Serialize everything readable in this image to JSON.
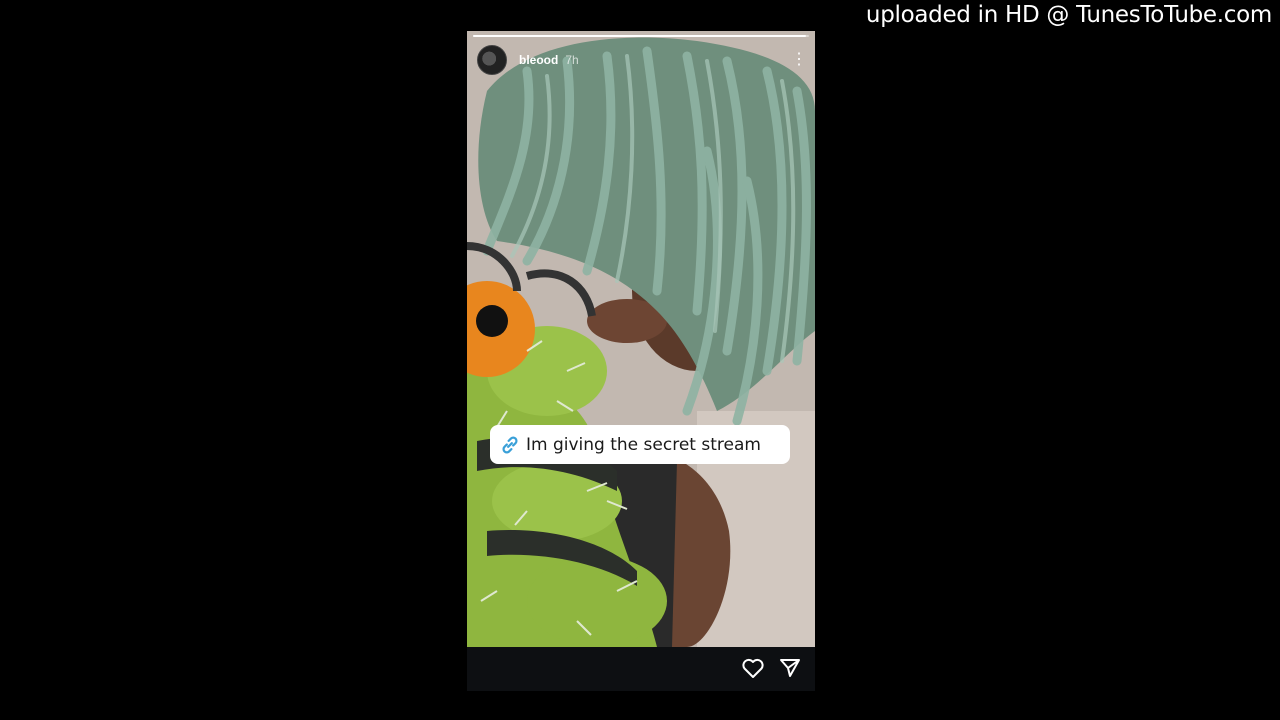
{
  "watermark": {
    "text": "uploaded in HD @ TunesToTube.com"
  },
  "story": {
    "progress": 0.99,
    "username": "bleood",
    "time_ago": "7h",
    "link_sticker": {
      "text": "Im giving the secret stream",
      "icon": "link-icon"
    },
    "footer": {
      "like_icon": "heart-icon",
      "share_icon": "send-icon"
    }
  },
  "colors": {
    "background": "#000000",
    "hair": "#7fa493",
    "worm_green": "#9bc24a",
    "worm_orange": "#e8861e",
    "link_blue": "#3aa0d8"
  }
}
